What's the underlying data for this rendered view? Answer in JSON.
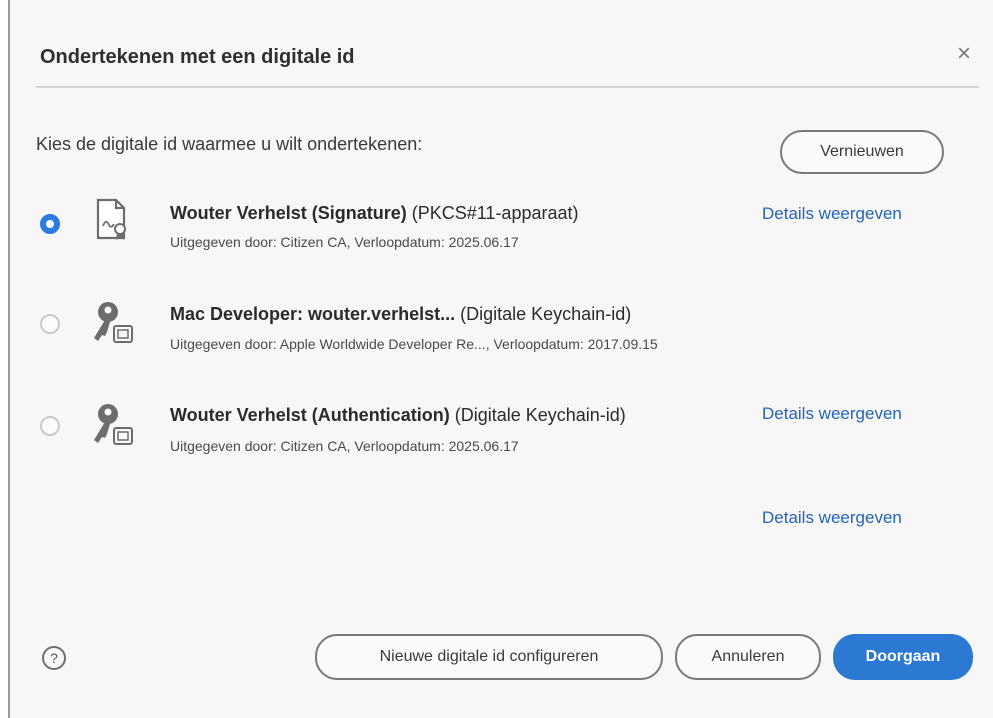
{
  "dialog": {
    "title": "Ondertekenen met een digitale id",
    "close_symbol": "×",
    "prompt": "Kies de digitale id waarmee u wilt ondertekenen:",
    "refresh_label": "Vernieuwen"
  },
  "ids": [
    {
      "selected": true,
      "icon": "certificate-icon",
      "name": "Wouter Verhelst (Signature)",
      "type": "(PKCS#11-apparaat)",
      "meta": "Uitgegeven door: Citizen CA, Verloopdatum: 2025.06.17",
      "details_label": "Details weergeven"
    },
    {
      "selected": false,
      "icon": "keychain-icon",
      "name": "Mac Developer: wouter.verhelst...",
      "type": "(Digitale Keychain-id)",
      "meta": "Uitgegeven door: Apple Worldwide Developer Re..., Verloopdatum: 2017.09.15",
      "details_label": "Details weergeven"
    },
    {
      "selected": false,
      "icon": "keychain-icon",
      "name": "Wouter Verhelst (Authentication)",
      "type": "(Digitale Keychain-id)",
      "meta": "Uitgegeven door: Citizen CA, Verloopdatum: 2025.06.17",
      "details_label": "Details weergeven"
    }
  ],
  "footer": {
    "help_symbol": "?",
    "configure_label": "Nieuwe digitale id configureren",
    "cancel_label": "Annuleren",
    "continue_label": "Doorgaan"
  },
  "colors": {
    "accent": "#2c79d4",
    "link": "#2565b8",
    "background": "#f7f7f7"
  }
}
